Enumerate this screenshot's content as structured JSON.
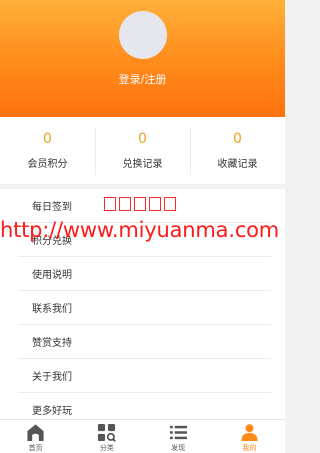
{
  "header": {
    "login_label": "登录/注册",
    "gradient_top": "#ffb03a",
    "gradient_bottom": "#ff7210"
  },
  "stats": [
    {
      "value": "0",
      "label": "会员积分"
    },
    {
      "value": "0",
      "label": "兑换记录"
    },
    {
      "value": "0",
      "label": "收藏记录"
    }
  ],
  "menu": [
    {
      "label": "每日签到"
    },
    {
      "label": "积分兑换"
    },
    {
      "label": "使用说明"
    },
    {
      "label": "联系我们"
    },
    {
      "label": "赞赏支持"
    },
    {
      "label": "关于我们"
    },
    {
      "label": "更多好玩"
    }
  ],
  "watermark": {
    "url": "http://www.miyuanma.com",
    "color": "#ff1a1a"
  },
  "tabbar": {
    "active_color": "#ff8a1a",
    "tabs": [
      {
        "label": "首页",
        "icon": "home-icon"
      },
      {
        "label": "分类",
        "icon": "category-grid-icon"
      },
      {
        "label": "发现",
        "icon": "list-icon"
      },
      {
        "label": "我的",
        "icon": "user-icon"
      }
    ]
  }
}
